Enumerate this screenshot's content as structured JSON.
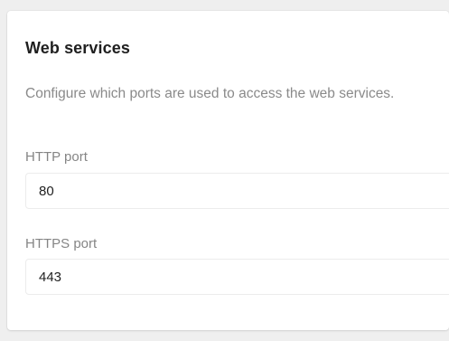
{
  "section": {
    "title": "Web services",
    "description": "Configure which ports are used to access the web services."
  },
  "fields": {
    "http": {
      "label": "HTTP port",
      "value": "80"
    },
    "https": {
      "label": "HTTPS port",
      "value": "443"
    }
  }
}
